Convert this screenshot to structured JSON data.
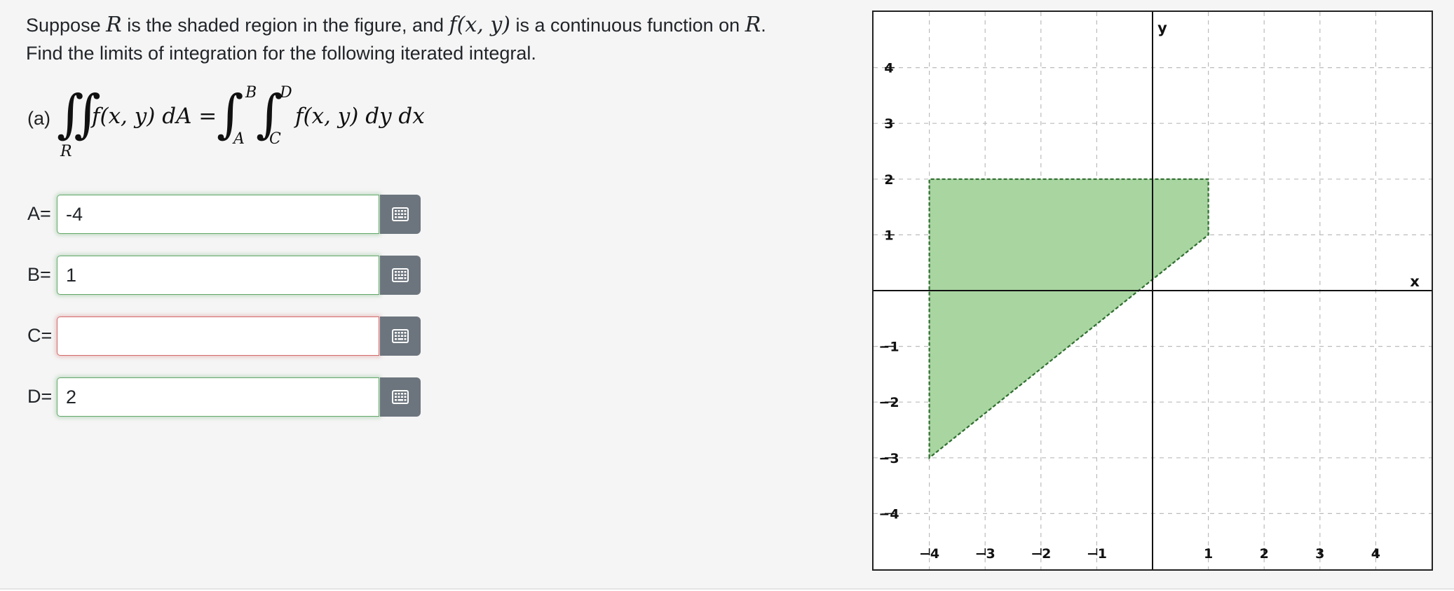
{
  "question": {
    "line1_prefix": "Suppose ",
    "region_symbol": "R",
    "line1_middle": " is the shaded region in the figure, and ",
    "function_expr": "f(x, y)",
    "line1_middle2": " is a continuous function on ",
    "region_symbol2": "R",
    "line1_end": ".",
    "line2": "Find the limits of integration for the following iterated integral."
  },
  "equation": {
    "part_label": "(a)",
    "double_integral_sign": "∬",
    "region_subscript": "R",
    "lhs_text": "f(x, y) dA =",
    "outer_upper": "B",
    "outer_lower": "A",
    "inner_upper": "D",
    "inner_lower": "C",
    "single_integral_sign": "∫",
    "rhs_text": "f(x, y) dy dx"
  },
  "answers": [
    {
      "label": "A=",
      "value": "-4",
      "status": "correct"
    },
    {
      "label": "B=",
      "value": "1",
      "status": "correct"
    },
    {
      "label": "C=",
      "value": "",
      "status": "incorrect"
    },
    {
      "label": "D=",
      "value": "2",
      "status": "correct"
    }
  ],
  "keypad_icon": "keypad-grid-icon",
  "graph": {
    "x_axis_name": "x",
    "y_axis_name": "y",
    "x_range": [
      -5,
      5
    ],
    "y_range": [
      -5,
      5
    ],
    "x_tick_labels": [
      "−4",
      "−3",
      "−2",
      "−1",
      "1",
      "2",
      "3",
      "4"
    ],
    "x_tick_values": [
      -4,
      -3,
      -2,
      -1,
      1,
      2,
      3,
      4
    ],
    "y_tick_labels": [
      "4",
      "3",
      "2",
      "1",
      "−1",
      "−2",
      "−3",
      "−4"
    ],
    "y_tick_values": [
      4,
      3,
      2,
      1,
      -1,
      -2,
      -3,
      -4
    ],
    "grid": "dashed",
    "region_vertices": [
      [
        -4,
        -3
      ],
      [
        -4,
        2
      ],
      [
        1,
        2
      ],
      [
        1,
        1
      ]
    ],
    "region_fill": "#a8d5a0",
    "region_stroke": "#2f6e2f"
  }
}
